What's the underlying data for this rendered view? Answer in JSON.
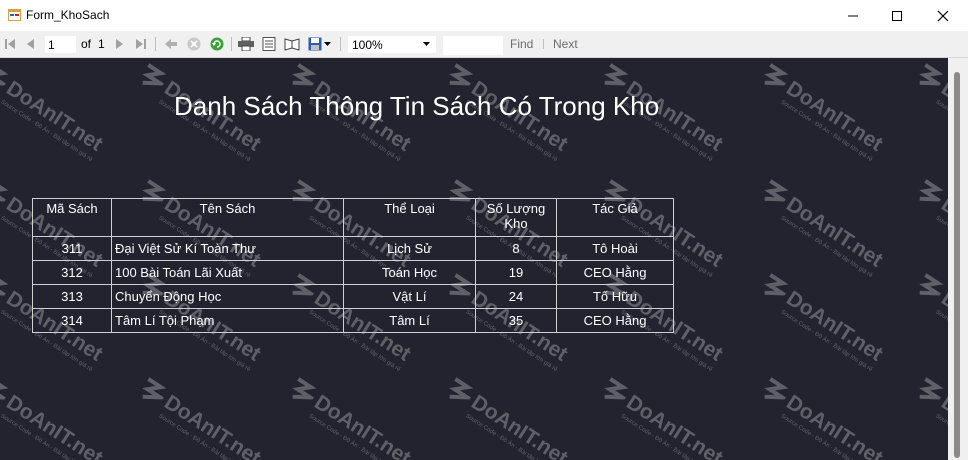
{
  "window": {
    "title": "Form_KhoSach"
  },
  "toolbar": {
    "page_current": "1",
    "page_of_label": "of",
    "page_total": "1",
    "zoom_value": "100%",
    "find_value": "",
    "find_label": "Find",
    "next_label": "Next"
  },
  "report": {
    "title": "Danh Sách Thông Tin Sách Có Trong Kho",
    "columns": [
      "Mã Sách",
      "Tên Sách",
      "Thể Loại",
      "Số Lượng Kho",
      "Tác Giả"
    ],
    "rows": [
      [
        "311",
        "Đại Việt Sử Kí Toàn Thư",
        "Lịch Sử",
        "8",
        "Tô Hoài"
      ],
      [
        "312",
        "100 Bài Toán Lãi Xuất",
        "Toán Học",
        "19",
        "CEO Hằng"
      ],
      [
        "313",
        "Chuyển Động Học",
        "Vật Lí",
        "24",
        "Tố Hữu"
      ],
      [
        "314",
        "Tâm Lí Tội Phạm",
        "Tâm Lí",
        "35",
        "CEO Hằng"
      ]
    ]
  },
  "watermark": {
    "text": "DoAnIT.net",
    "subtext": "Source Code - Đồ Án - Bài tập lớn giá rẻ"
  }
}
